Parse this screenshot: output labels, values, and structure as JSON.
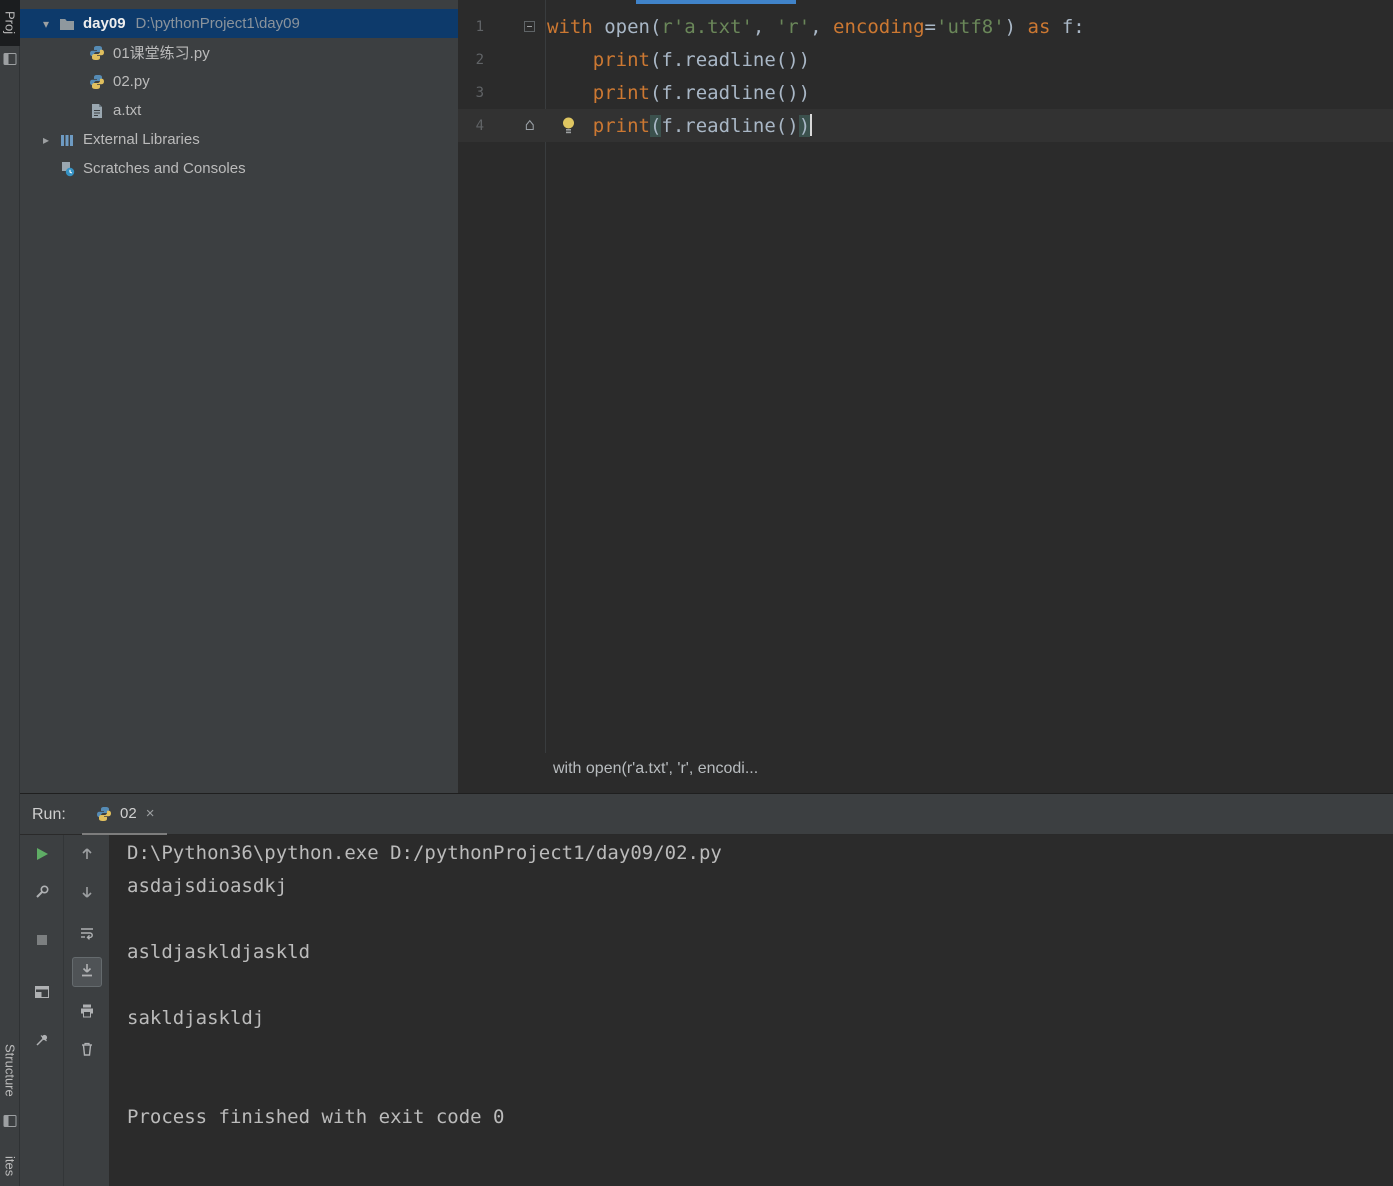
{
  "stripe": {
    "project_label": "Proj",
    "structure_label": "Structure",
    "favorites_label": "ites"
  },
  "project": {
    "root_name": "day09",
    "root_path": "D:\\pythonProject1\\day09",
    "items": [
      {
        "label": "01课堂练习.py",
        "icon": "python-file-icon",
        "depth": 1,
        "chevron": null
      },
      {
        "label": "02.py",
        "icon": "python-file-icon",
        "depth": 1,
        "chevron": null
      },
      {
        "label": "a.txt",
        "icon": "text-file-icon",
        "depth": 1,
        "chevron": null
      },
      {
        "label": "External Libraries",
        "icon": "libraries-icon",
        "depth": 0,
        "chevron": "right"
      },
      {
        "label": "Scratches and Consoles",
        "icon": "scratches-icon",
        "depth": 0,
        "chevron": null
      }
    ]
  },
  "editor": {
    "lines": [
      {
        "num": "1",
        "fold": true,
        "tokens": [
          {
            "t": "with",
            "c": "kw"
          },
          {
            "t": " open(",
            "c": "plain"
          },
          {
            "t": "r'a.txt'",
            "c": "str"
          },
          {
            "t": ", ",
            "c": "plain"
          },
          {
            "t": "'r'",
            "c": "str"
          },
          {
            "t": ", ",
            "c": "plain"
          },
          {
            "t": "encoding",
            "c": "kw"
          },
          {
            "t": "=",
            "c": "plain"
          },
          {
            "t": "'utf8'",
            "c": "str"
          },
          {
            "t": ") ",
            "c": "plain"
          },
          {
            "t": "as",
            "c": "kw"
          },
          {
            "t": " f:",
            "c": "plain"
          }
        ]
      },
      {
        "num": "2",
        "tokens": [
          {
            "t": "    ",
            "c": "plain"
          },
          {
            "t": "print",
            "c": "kw"
          },
          {
            "t": "(f.readline())",
            "c": "plain"
          }
        ]
      },
      {
        "num": "3",
        "tokens": [
          {
            "t": "    ",
            "c": "plain"
          },
          {
            "t": "print",
            "c": "kw"
          },
          {
            "t": "(f.readline())",
            "c": "plain"
          }
        ]
      },
      {
        "num": "4",
        "current": true,
        "bookmark": true,
        "bulb": true,
        "cursor_end": true,
        "tokens": [
          {
            "t": "    ",
            "c": "plain"
          },
          {
            "t": "print",
            "c": "kw"
          },
          {
            "t": "(",
            "c": "plain",
            "hl": true
          },
          {
            "t": "f.readline()",
            "c": "plain"
          },
          {
            "t": ")",
            "c": "plain",
            "hl": true
          }
        ]
      }
    ],
    "hint": "with open(r'a.txt', 'r', encodi..."
  },
  "run": {
    "label": "Run:",
    "tab_label": "02",
    "tab_close": "×",
    "toolbar_main": [
      {
        "name": "rerun-button",
        "icon": "run-icon"
      },
      {
        "name": "run-settings-button",
        "icon": "wrench-icon"
      },
      {
        "name": "stop-button",
        "icon": "stop-icon"
      },
      {
        "name": "restore-layout-button",
        "icon": "restore-layout-icon"
      },
      {
        "name": "pin-tab-button",
        "icon": "pin-icon"
      }
    ],
    "toolbar_console": [
      {
        "name": "up-stacktrace-button",
        "icon": "up-arrow-icon"
      },
      {
        "name": "down-stacktrace-button",
        "icon": "down-arrow-icon"
      },
      {
        "name": "soft-wrap-button",
        "icon": "softwrap-icon"
      },
      {
        "name": "scroll-to-end-button",
        "icon": "scroll-end-icon",
        "selected": true
      },
      {
        "name": "print-console-button",
        "icon": "print-icon"
      },
      {
        "name": "clear-console-button",
        "icon": "trash-icon"
      }
    ],
    "console_lines": [
      "D:\\Python36\\python.exe D:/pythonProject1/day09/02.py",
      "asdajsdioasdkj",
      "",
      "asldjaskldjaskld",
      "",
      "sakldjaskldj",
      "",
      "",
      "Process finished with exit code 0"
    ]
  },
  "palette": {
    "keyword": "#cc7832",
    "string": "#6a8759",
    "code_text": "#a9b7c6",
    "selection_blue": "#0d3a6b",
    "progress_blue": "#4083c9",
    "run_green": "#5fad65",
    "console_text": "#bbbbbb"
  }
}
